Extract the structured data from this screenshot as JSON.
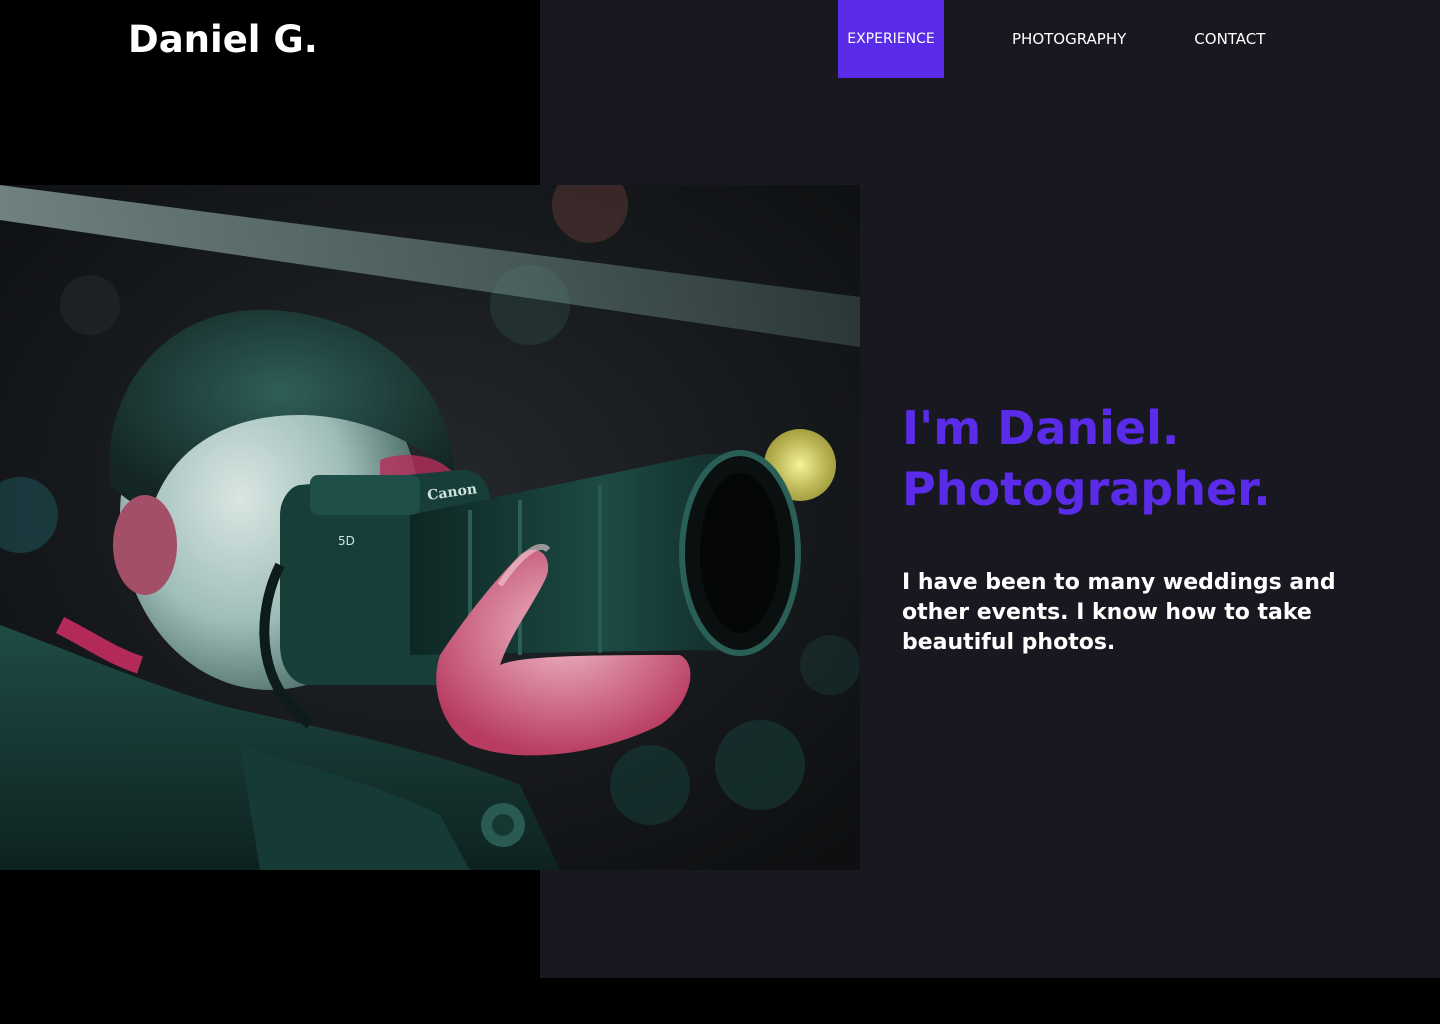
{
  "header": {
    "logo": "Daniel G."
  },
  "nav": {
    "items": [
      {
        "label": "EXPERIENCE",
        "active": true
      },
      {
        "label": "PHOTOGRAPHY",
        "active": false
      },
      {
        "label": "CONTACT",
        "active": false
      }
    ]
  },
  "hero": {
    "image": {
      "camera_brand": "Canon",
      "camera_model": "5D"
    },
    "headline_line1": "I'm Daniel.",
    "headline_line2": "Photographer.",
    "bio": "I have been to many weddings and other events. I know how to take beautiful photos."
  },
  "colors": {
    "accent": "#5a2be8",
    "panel": "#181820",
    "background": "#000000",
    "text": "#ffffff"
  }
}
